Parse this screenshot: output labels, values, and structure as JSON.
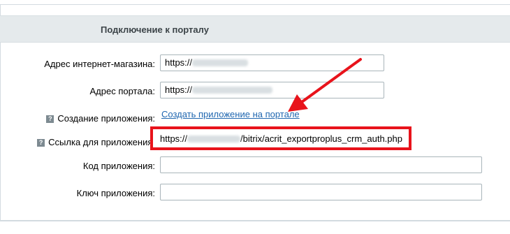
{
  "section": {
    "title": "Подключение к порталу"
  },
  "fields": {
    "shop_url": {
      "label": "Адрес интернет-магазина:",
      "value": "https://"
    },
    "portal_url": {
      "label": "Адрес портала:",
      "value": "https://"
    },
    "create_app": {
      "label": "Создание приложения:",
      "link": "Создать приложение на портале"
    },
    "callback": {
      "label": "Ссылка для приложения:",
      "prefix": "https://",
      "suffix": "/bitrix/acrit_exportproplus_crm_auth.php"
    },
    "app_code": {
      "label": "Код приложения:",
      "value": ""
    },
    "app_key": {
      "label": "Ключ приложения:",
      "value": ""
    }
  },
  "help_icon": "?",
  "colors": {
    "highlight": "#e8131b",
    "link": "#2067b0",
    "header_bg": "#e5eaec"
  }
}
